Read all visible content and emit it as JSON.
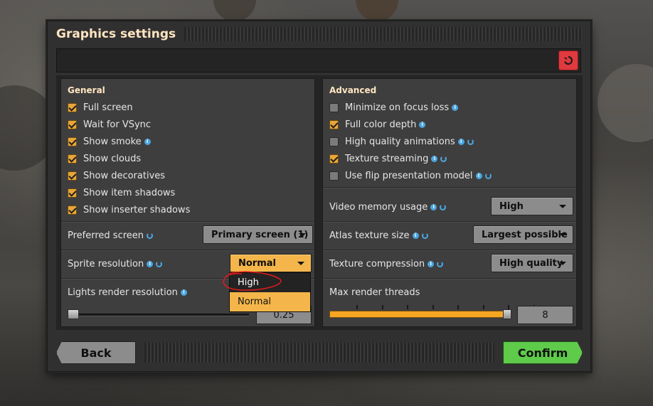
{
  "dialog": {
    "title": "Graphics settings"
  },
  "toolbar": {
    "reset_icon": "reset-icon"
  },
  "general": {
    "title": "General",
    "checkboxes": [
      {
        "label": "Full screen",
        "checked": true,
        "info": false,
        "reset": false
      },
      {
        "label": "Wait for VSync",
        "checked": true,
        "info": false,
        "reset": false
      },
      {
        "label": "Show smoke",
        "checked": true,
        "info": true,
        "reset": false
      },
      {
        "label": "Show clouds",
        "checked": true,
        "info": false,
        "reset": false
      },
      {
        "label": "Show decoratives",
        "checked": true,
        "info": false,
        "reset": false
      },
      {
        "label": "Show item shadows",
        "checked": true,
        "info": false,
        "reset": false
      },
      {
        "label": "Show inserter shadows",
        "checked": true,
        "info": false,
        "reset": false
      }
    ],
    "preferred_screen": {
      "label": "Preferred screen",
      "value": "Primary screen (1)"
    },
    "sprite_resolution": {
      "label": "Sprite resolution",
      "value": "Normal",
      "options": [
        "High",
        "Normal"
      ],
      "highlighted": "High",
      "selected": "Normal"
    },
    "lights_render_resolution": {
      "label": "Lights render resolution",
      "value": "0.25",
      "fraction": 0.0
    }
  },
  "advanced": {
    "title": "Advanced",
    "checkboxes": [
      {
        "label": "Minimize on focus loss",
        "checked": false,
        "info": true,
        "reset": false
      },
      {
        "label": "Full color depth",
        "checked": true,
        "info": true,
        "reset": false
      },
      {
        "label": "High quality animations",
        "checked": false,
        "info": true,
        "reset": true
      },
      {
        "label": "Texture streaming",
        "checked": true,
        "info": true,
        "reset": true
      },
      {
        "label": "Use flip presentation model",
        "checked": false,
        "info": true,
        "reset": true
      }
    ],
    "video_memory_usage": {
      "label": "Video memory usage",
      "value": "High"
    },
    "atlas_texture_size": {
      "label": "Atlas texture size",
      "value": "Largest possible"
    },
    "texture_compression": {
      "label": "Texture compression",
      "value": "High quality"
    },
    "max_render_threads": {
      "label": "Max render threads",
      "value": "8",
      "fraction": 1.0,
      "ticks": 8
    }
  },
  "footer": {
    "back_label": "Back",
    "confirm_label": "Confirm"
  },
  "colors": {
    "accent_orange": "#f4b64a",
    "confirm_green": "#5ecb4a",
    "reset_red": "#e0393e",
    "title_cream": "#ffe6c0",
    "info_blue": "#4ba6e0"
  }
}
